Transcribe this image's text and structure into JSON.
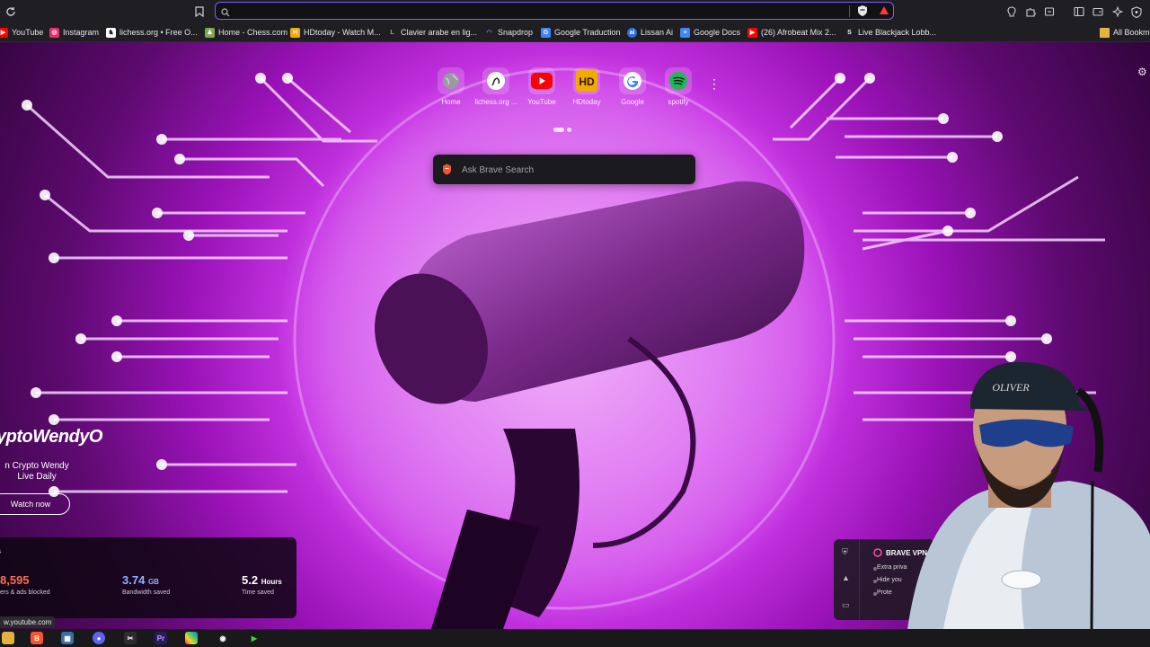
{
  "toolbar": {
    "address_value": "",
    "icons": [
      "reload-icon",
      "bookmark-icon",
      "search-icon",
      "brave-shields-icon",
      "brave-rewards-icon",
      "leo-ai-icon",
      "extensions-icon",
      "downloads-icon",
      "sidebar-icon",
      "wallet-icon",
      "vpn-icon"
    ]
  },
  "bookmarks": {
    "items": [
      {
        "label": "YouTube",
        "icon": "youtube-icon",
        "color": "#ff0000"
      },
      {
        "label": "Instagram",
        "icon": "instagram-icon",
        "color": "#e1306c"
      },
      {
        "label": "lichess.org • Free O...",
        "icon": "lichess-icon",
        "color": "#444444"
      },
      {
        "label": "Home - Chess.com",
        "icon": "chesscom-icon",
        "color": "#7fa650"
      },
      {
        "label": "HDtoday - Watch M...",
        "icon": "hdtoday-icon",
        "color": "#f2a900"
      },
      {
        "label": "Clavier arabe en lig...",
        "icon": "clavier-icon",
        "color": "#2e8b57"
      },
      {
        "label": "Snapdrop",
        "icon": "snapdrop-icon",
        "color": "#3f51b5"
      },
      {
        "label": "Google Traduction",
        "icon": "google-translate-icon",
        "color": "#4285f4"
      },
      {
        "label": "Lissan Ai",
        "icon": "lissan-icon",
        "color": "#2a6fdb"
      },
      {
        "label": "Google Docs",
        "icon": "google-docs-icon",
        "color": "#4285f4"
      },
      {
        "label": "(26) Afrobeat Mix 2...",
        "icon": "youtube-icon",
        "color": "#ff0000"
      },
      {
        "label": "Live Blackjack Lobb...",
        "icon": "blackjack-icon",
        "color": "#222222"
      }
    ],
    "all_bookmarks": "All Bookma"
  },
  "top_sites": [
    {
      "label": "Home",
      "icon": "globe-icon",
      "color": "#8a8a92"
    },
    {
      "label": "lichess.org ...",
      "icon": "lichess-icon",
      "color": "#ffffff"
    },
    {
      "label": "YouTube",
      "icon": "youtube-icon",
      "color": "#ff0000"
    },
    {
      "label": "HDtoday",
      "icon": "hdtoday-icon",
      "color": "#f2a900"
    },
    {
      "label": "Google",
      "icon": "google-icon",
      "color": "#ffffff"
    },
    {
      "label": "spotify",
      "icon": "spotify-icon",
      "color": "#1db954"
    }
  ],
  "search": {
    "placeholder": "Ask Brave Search"
  },
  "promo": {
    "title": "yptoWendyO",
    "subtitle": "n Crypto Wendy Live Daily",
    "button": "Watch now"
  },
  "stats": {
    "heading": "s",
    "items": [
      {
        "value": "8,595",
        "unit": "",
        "caption": "ers & ads blocked",
        "color": "#ff6f4f"
      },
      {
        "value": "3.74",
        "unit": "GB",
        "caption": "Bandwidth saved",
        "color": "#8fb3ff"
      },
      {
        "value": "5.2",
        "unit": "Hours",
        "caption": "Time saved",
        "color": "#ffffff"
      }
    ]
  },
  "vpn": {
    "title": "BRAVE VPN",
    "lines": [
      "Extra priva",
      "Hide you",
      "Prote"
    ]
  },
  "status_url": "w.youtube.com",
  "colors": {
    "accent": "#7b5cff",
    "toolbar": "#1f1f23",
    "brave_orange": "#fb542b"
  }
}
